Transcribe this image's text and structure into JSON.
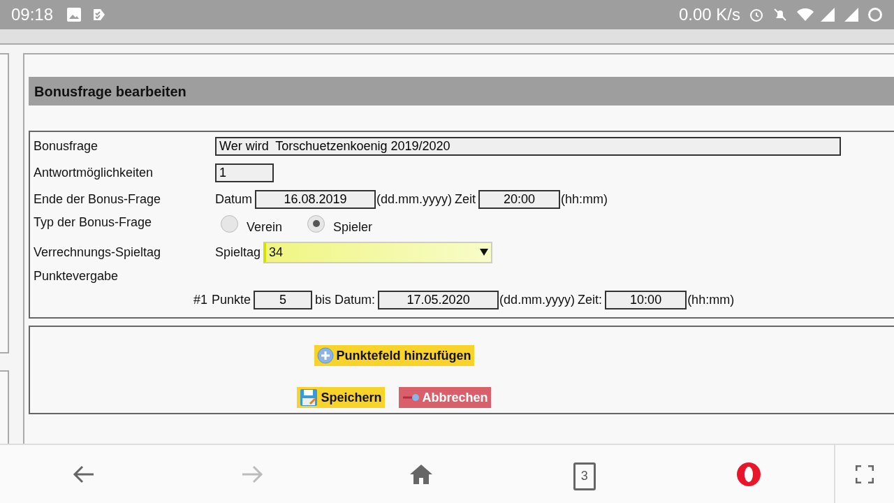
{
  "status_bar": {
    "time": "09:18",
    "net_speed": "0.00 K/s"
  },
  "heading": "Bonusfrage bearbeiten",
  "form": {
    "question": {
      "label": "Bonusfrage",
      "value": "Wer wird  Torschuetzenkoenig 2019/2020"
    },
    "answers": {
      "label": "Antwortmöglichkeiten",
      "value": "1"
    },
    "end": {
      "label": "Ende der Bonus-Frage",
      "date_label": "Datum",
      "date": "16.08.2019",
      "date_hint": "(dd.mm.yyyy)",
      "time_label": "Zeit",
      "time": "20:00",
      "time_hint": "(hh:mm)"
    },
    "type": {
      "label": "Typ der Bonus-Frage",
      "options": [
        {
          "label": "Verein",
          "selected": false
        },
        {
          "label": "Spieler",
          "selected": true
        }
      ]
    },
    "matchday": {
      "label": "Verrechnungs-Spieltag",
      "prefix": "Spieltag",
      "value": "34"
    },
    "points": {
      "label": "Punktevergabe",
      "rows": [
        {
          "index": "#1",
          "points_label": "Punkte",
          "points": "5",
          "date_label": "bis Datum:",
          "date": "17.05.2020",
          "date_hint": "(dd.mm.yyyy)",
          "time_label": "Zeit:",
          "time": "10:00",
          "time_hint": "(hh:mm)"
        }
      ]
    }
  },
  "add_button": "Punktefeld hinzufügen",
  "save_button": "Speichern",
  "cancel_button": "Abbrechen",
  "nav": {
    "back_disabled": false,
    "forward_disabled": true,
    "tab_count": "3"
  }
}
